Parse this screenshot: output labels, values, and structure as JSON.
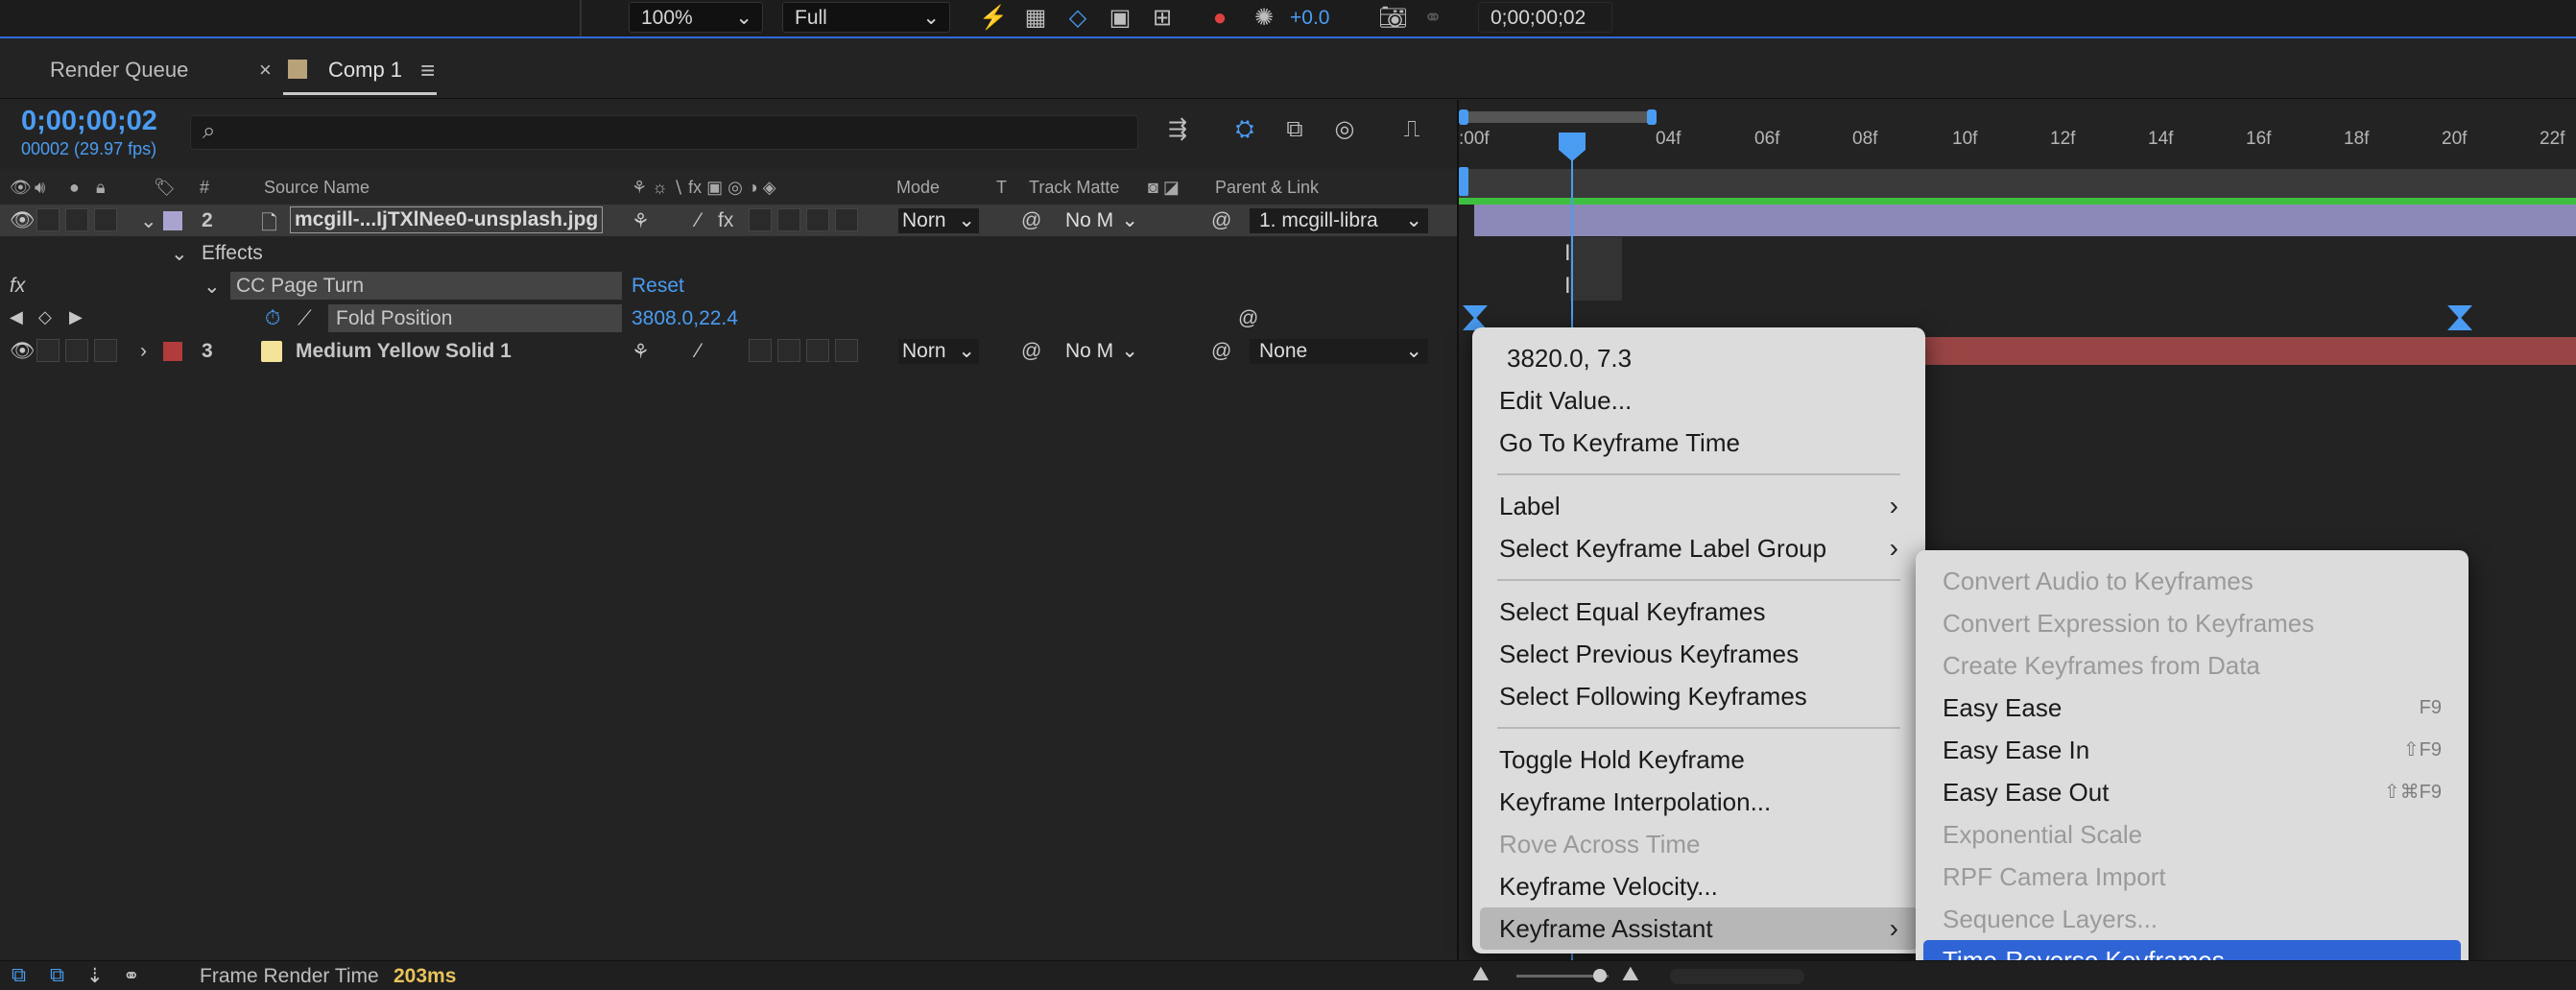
{
  "toolbar": {
    "zoom": "100%",
    "resolution": "Full",
    "exposure": "+0.0",
    "timecode": "0;00;00;02"
  },
  "tabs": {
    "render_queue": "Render Queue",
    "close": "×",
    "comp": "Comp 1",
    "menu": "≡"
  },
  "timeline": {
    "current_time": "0;00;00;02",
    "frame_info": "00002 (29.97 fps)",
    "search_icon": "⌕"
  },
  "columns": {
    "number": "#",
    "source_name": "Source Name",
    "mode": "Mode",
    "t": "T",
    "track_matte": "Track Matte",
    "parent_link": "Parent & Link"
  },
  "layers": [
    {
      "number": "2",
      "name": "mcgill-...IjTXlNee0-unsplash.jpg",
      "mode": "Norn",
      "matte": "No M",
      "parent": "1. mcgill-libra",
      "label_color": "#a9a4cf",
      "effects_label": "Effects",
      "effect_name": "CC Page Turn",
      "effect_reset": "Reset",
      "property_name": "Fold Position",
      "property_value": "3808.0,22.4"
    },
    {
      "number": "3",
      "name": "Medium Yellow Solid 1",
      "mode": "Norn",
      "matte": "No M",
      "parent": "None",
      "label_color": "#b23b3b",
      "swatch_color": "#f5e39a"
    }
  ],
  "ruler": {
    "ticks": [
      ":00f",
      "04f",
      "06f",
      "08f",
      "10f",
      "12f",
      "14f",
      "16f",
      "18f",
      "20f",
      "22f"
    ]
  },
  "context_menu": {
    "value_line": "3820.0, 7.3",
    "items": [
      {
        "label": "Edit Value...",
        "enabled": true
      },
      {
        "label": "Go To Keyframe Time",
        "enabled": true
      },
      {
        "label": "Label",
        "enabled": true,
        "submenu": true
      },
      {
        "label": "Select Keyframe Label Group",
        "enabled": true,
        "submenu": true
      },
      {
        "label": "Select Equal Keyframes",
        "enabled": true
      },
      {
        "label": "Select Previous Keyframes",
        "enabled": true
      },
      {
        "label": "Select Following Keyframes",
        "enabled": true
      },
      {
        "label": "Toggle Hold Keyframe",
        "enabled": true
      },
      {
        "label": "Keyframe Interpolation...",
        "enabled": true
      },
      {
        "label": "Rove Across Time",
        "enabled": false
      },
      {
        "label": "Keyframe Velocity...",
        "enabled": true
      },
      {
        "label": "Keyframe Assistant",
        "enabled": true,
        "submenu": true,
        "highlighted": true
      }
    ]
  },
  "submenu": {
    "items": [
      {
        "label": "Convert Audio to Keyframes",
        "enabled": false,
        "shortcut": ""
      },
      {
        "label": "Convert Expression to Keyframes",
        "enabled": false,
        "shortcut": ""
      },
      {
        "label": "Create Keyframes from Data",
        "enabled": false,
        "shortcut": ""
      },
      {
        "label": "Easy Ease",
        "enabled": true,
        "shortcut": "F9"
      },
      {
        "label": "Easy Ease In",
        "enabled": true,
        "shortcut": "⇧F9"
      },
      {
        "label": "Easy Ease Out",
        "enabled": true,
        "shortcut": "⇧⌘F9"
      },
      {
        "label": "Exponential Scale",
        "enabled": false,
        "shortcut": ""
      },
      {
        "label": "RPF Camera Import",
        "enabled": false,
        "shortcut": ""
      },
      {
        "label": "Sequence Layers...",
        "enabled": false,
        "shortcut": ""
      },
      {
        "label": "Time-Reverse Keyframes",
        "enabled": true,
        "shortcut": "",
        "highlighted": true
      }
    ]
  },
  "status": {
    "label": "Frame Render Time",
    "value": "203ms"
  },
  "colors": {
    "accent": "#2d6ad9",
    "menu_highlight": "#2f64d6",
    "timecode_blue": "#4a9cf2",
    "layer2_bar": "#8c89b8",
    "layer3_bar": "#9a4545",
    "green_bar": "#3fbf3f"
  }
}
